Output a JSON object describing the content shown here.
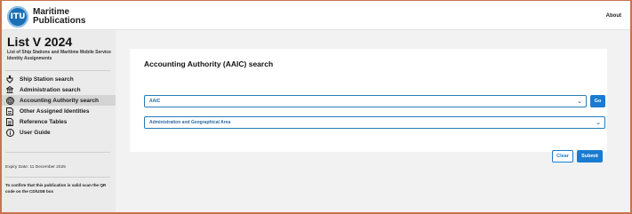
{
  "header": {
    "logo_mark": "ITU",
    "logo_line1": "Maritime",
    "logo_line2": "Publications",
    "about": "About"
  },
  "sidebar": {
    "title": "List V 2024",
    "subtitle": "List of Ship Stations and Maritime Mobile Service Identity Assignments",
    "items": [
      {
        "label": "Ship Station search",
        "icon": "ship-icon",
        "active": false
      },
      {
        "label": "Administration search",
        "icon": "institution-icon",
        "active": false
      },
      {
        "label": "Accounting Authority search",
        "icon": "fingerprint-icon",
        "active": true
      },
      {
        "label": "Other Assigned Identities",
        "icon": "document-icon",
        "active": false
      },
      {
        "label": "Reference Tables",
        "icon": "table-icon",
        "active": false
      },
      {
        "label": "User Guide",
        "icon": "info-icon",
        "active": false
      }
    ],
    "expiry": "Expiry Date: 11 December 2025",
    "confirm": "To confirm that this publication is valid scan the QR code on the CD/USB box"
  },
  "main": {
    "title": "Accounting Authority (AAIC) search",
    "aaic_select": "AAIC",
    "area_select": "Administration and Geographical Area",
    "go_label": "Go",
    "clear_label": "Clear",
    "submit_label": "Submit"
  },
  "colors": {
    "accent": "#1a7bd1",
    "frame": "#c8734f",
    "sidebar_bg": "#ebebeb",
    "main_bg": "#f2f2f2"
  }
}
